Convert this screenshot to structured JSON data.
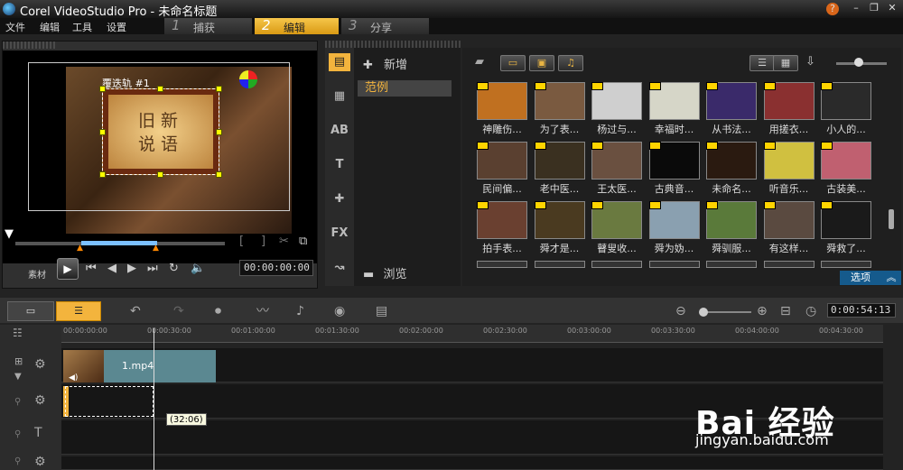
{
  "window": {
    "title": "Corel VideoStudio Pro - 未命名标题",
    "controls": [
      "help-icon",
      "minimize-icon",
      "restore-icon",
      "close-icon"
    ]
  },
  "menu": [
    "文件",
    "编辑",
    "工具",
    "设置"
  ],
  "steps": [
    {
      "num": "1",
      "label": "捕获",
      "active": false
    },
    {
      "num": "2",
      "label": "编辑",
      "active": true
    },
    {
      "num": "3",
      "label": "分享",
      "active": false
    }
  ],
  "preview": {
    "title_text_label": "覆迭轨 #1",
    "scroll_text_line1": "旧新",
    "scroll_text_line2": "说语",
    "source_label": "素材",
    "timecode": "00:00:00:00"
  },
  "library": {
    "add_label": "新增",
    "category": "范例",
    "browse_label": "浏览",
    "options_label": "选项",
    "thumbnails": [
      "神雕伤...",
      "为了表...",
      "杨过与...",
      "幸福时...",
      "从书法...",
      "用搓衣...",
      "小人的...",
      "民间偏...",
      "老中医...",
      "王太医...",
      "古典音...",
      "未命名...",
      "听音乐...",
      "古装美...",
      "拍手表...",
      "舜才是...",
      "瞽叟收...",
      "舜为妫...",
      "舜驯服...",
      "有这样...",
      "舜救了..."
    ]
  },
  "timeline": {
    "timecode": "0:00:54:13",
    "ruler_ticks": [
      "00:00:00:00",
      "00:00:30:00",
      "00:01:00:00",
      "00:01:30:00",
      "00:02:00:00",
      "00:02:30:00",
      "00:03:00:00",
      "00:03:30:00",
      "00:04:00:00",
      "00:04:30:00"
    ],
    "clip_name": "1.mp4",
    "tooltip": "(32:06)"
  },
  "watermark": {
    "brand": "Bai 经验",
    "url": "jingyan.baidu.com"
  }
}
